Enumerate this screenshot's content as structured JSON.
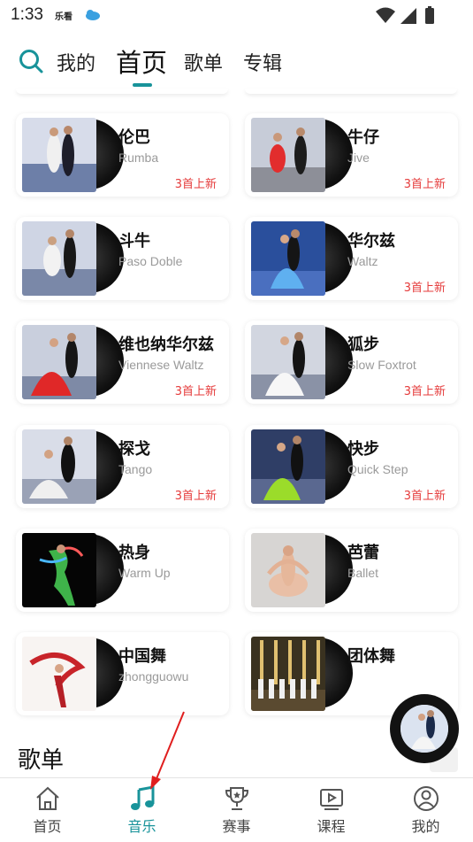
{
  "status_bar": {
    "time": "1:33",
    "app_label": "乐看"
  },
  "top_nav": {
    "tabs": [
      {
        "label": "我的"
      },
      {
        "label": "首页"
      },
      {
        "label": "歌单"
      },
      {
        "label": "专辑"
      }
    ],
    "active_tab": "首页",
    "accent_color": "#18939a"
  },
  "categories": [
    {
      "title": "伦巴",
      "subtitle": "Rumba",
      "badge": "3首上新"
    },
    {
      "title": "牛仔",
      "subtitle": "Jive",
      "badge": "3首上新"
    },
    {
      "title": "斗牛",
      "subtitle": "Paso Doble",
      "badge": ""
    },
    {
      "title": "华尔兹",
      "subtitle": "Waltz",
      "badge": "3首上新"
    },
    {
      "title": "维也纳华尔兹",
      "subtitle": "Viennese Waltz",
      "badge": "3首上新"
    },
    {
      "title": "狐步",
      "subtitle": "Slow Foxtrot",
      "badge": "3首上新"
    },
    {
      "title": "探戈",
      "subtitle": "Tango",
      "badge": "3首上新"
    },
    {
      "title": "快步",
      "subtitle": "Quick Step",
      "badge": "3首上新"
    },
    {
      "title": "热身",
      "subtitle": "Warm Up",
      "badge": ""
    },
    {
      "title": "芭蕾",
      "subtitle": "Ballet",
      "badge": ""
    },
    {
      "title": "中国舞",
      "subtitle": "zhongguowu",
      "badge": ""
    },
    {
      "title": "团体舞",
      "subtitle": "",
      "badge": ""
    }
  ],
  "section": {
    "title": "歌单"
  },
  "bottom_nav": {
    "items": [
      {
        "label": "首页",
        "icon": "home-icon"
      },
      {
        "label": "音乐",
        "icon": "music-note-icon"
      },
      {
        "label": "赛事",
        "icon": "trophy-icon"
      },
      {
        "label": "课程",
        "icon": "video-course-icon"
      },
      {
        "label": "我的",
        "icon": "profile-icon"
      }
    ],
    "active": "音乐"
  },
  "colors": {
    "badge": "#e53b3b",
    "accent": "#18939a",
    "subtitle": "#9a9a9a"
  }
}
